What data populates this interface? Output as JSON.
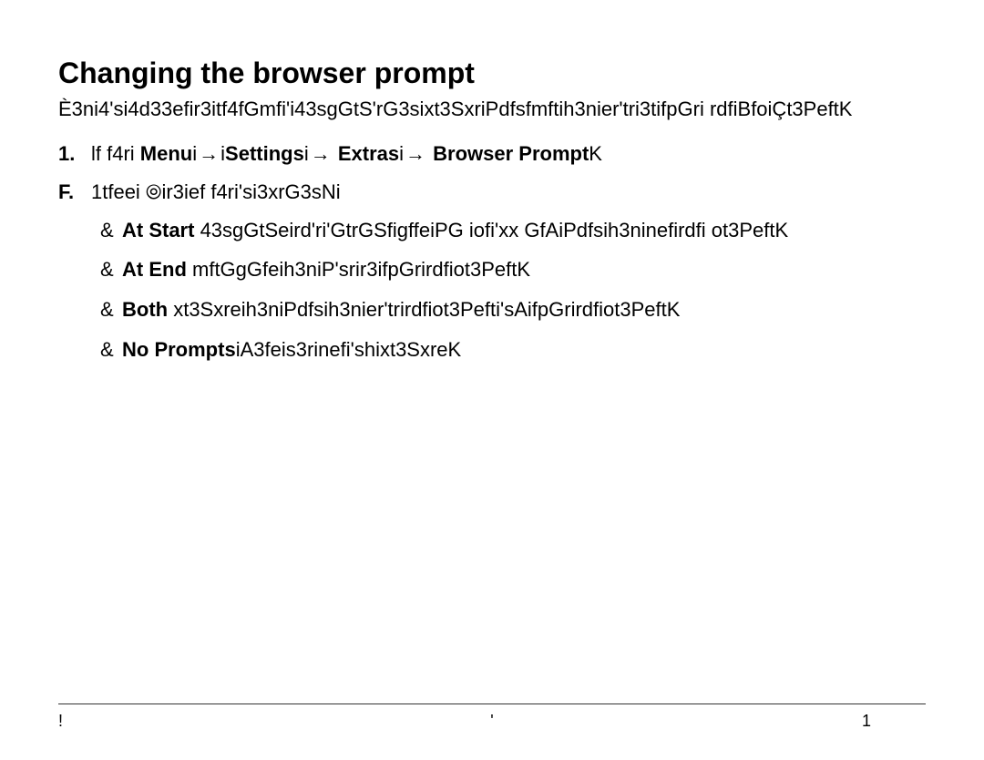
{
  "title": "Changing the browser prompt",
  "intro": "È3ni4'si4d33efir3itf4fGmfi'i43sgGtS'rG3sixt3SxriPdfsfmftih3nier'tri3tifpGri rdfiBfoiÇt3PeftK",
  "step1": {
    "marker": "1.",
    "lead": "lf f4ri  ",
    "menu": "Menu",
    "settings": "Settings",
    "extras": "Extras",
    "browser_prompt": "Browser Prompt",
    "sep_i": "i",
    "arrow": "→",
    "tail": "K"
  },
  "stepF": {
    "marker": "F.",
    "text": "1tfeei ⦾ir3ief f4ri'si3xrG3sNi"
  },
  "options": [
    {
      "mark": "&",
      "label": "At Start",
      "rest": " 43sgGtSeird'ri'GtrGSfigffeiPG  iofi'xx GfAiPdfsih3ninefirdfi ot3PeftK"
    },
    {
      "mark": "&",
      "label": "At End",
      "rest": " mftGgGfeih3niP'srir3ifpGrirdfiot3PeftK"
    },
    {
      "mark": "&",
      "label": "Both",
      "rest": " xt3Sxreih3niPdfsih3nier'trirdfiot3Pefti'sAifpGrirdfiot3PeftK"
    },
    {
      "mark": "&",
      "label": "No Prompts",
      "rest": "iA3feis3rinefi'shixt3SxreK"
    }
  ],
  "footer": {
    "left": "!",
    "center": "'",
    "right": "1"
  }
}
